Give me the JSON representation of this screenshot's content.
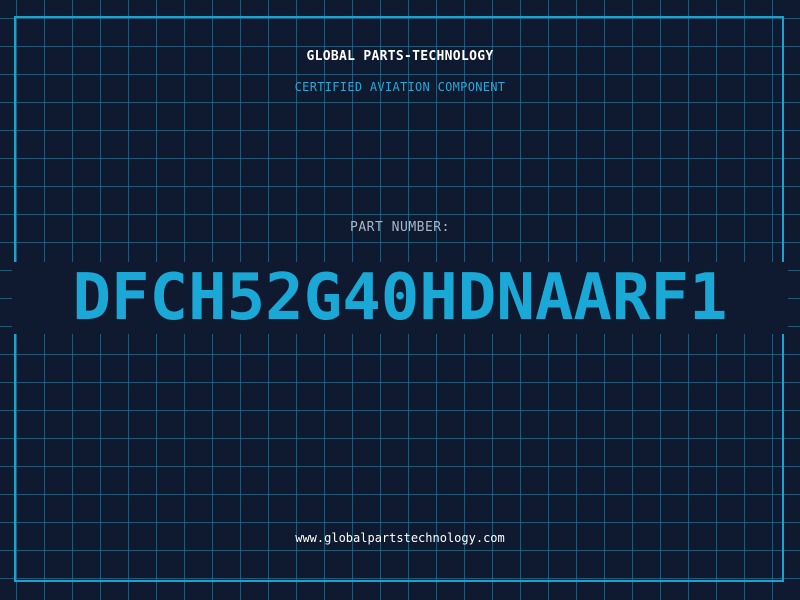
{
  "header": {
    "brand": "GLOBAL PARTS-TECHNOLOGY",
    "subtitle": "CERTIFIED AVIATION COMPONENT"
  },
  "part": {
    "label": "PART NUMBER:",
    "number": "DFCH52G40HDNAARF1"
  },
  "footer": {
    "website": "www.globalpartstechnology.com"
  },
  "colors": {
    "background": "#0f1a30",
    "grid": "#266e8c",
    "accent": "#1aa8d6",
    "frame": "#1aa3cc",
    "label": "#a9b6c7",
    "text": "#ffffff"
  }
}
